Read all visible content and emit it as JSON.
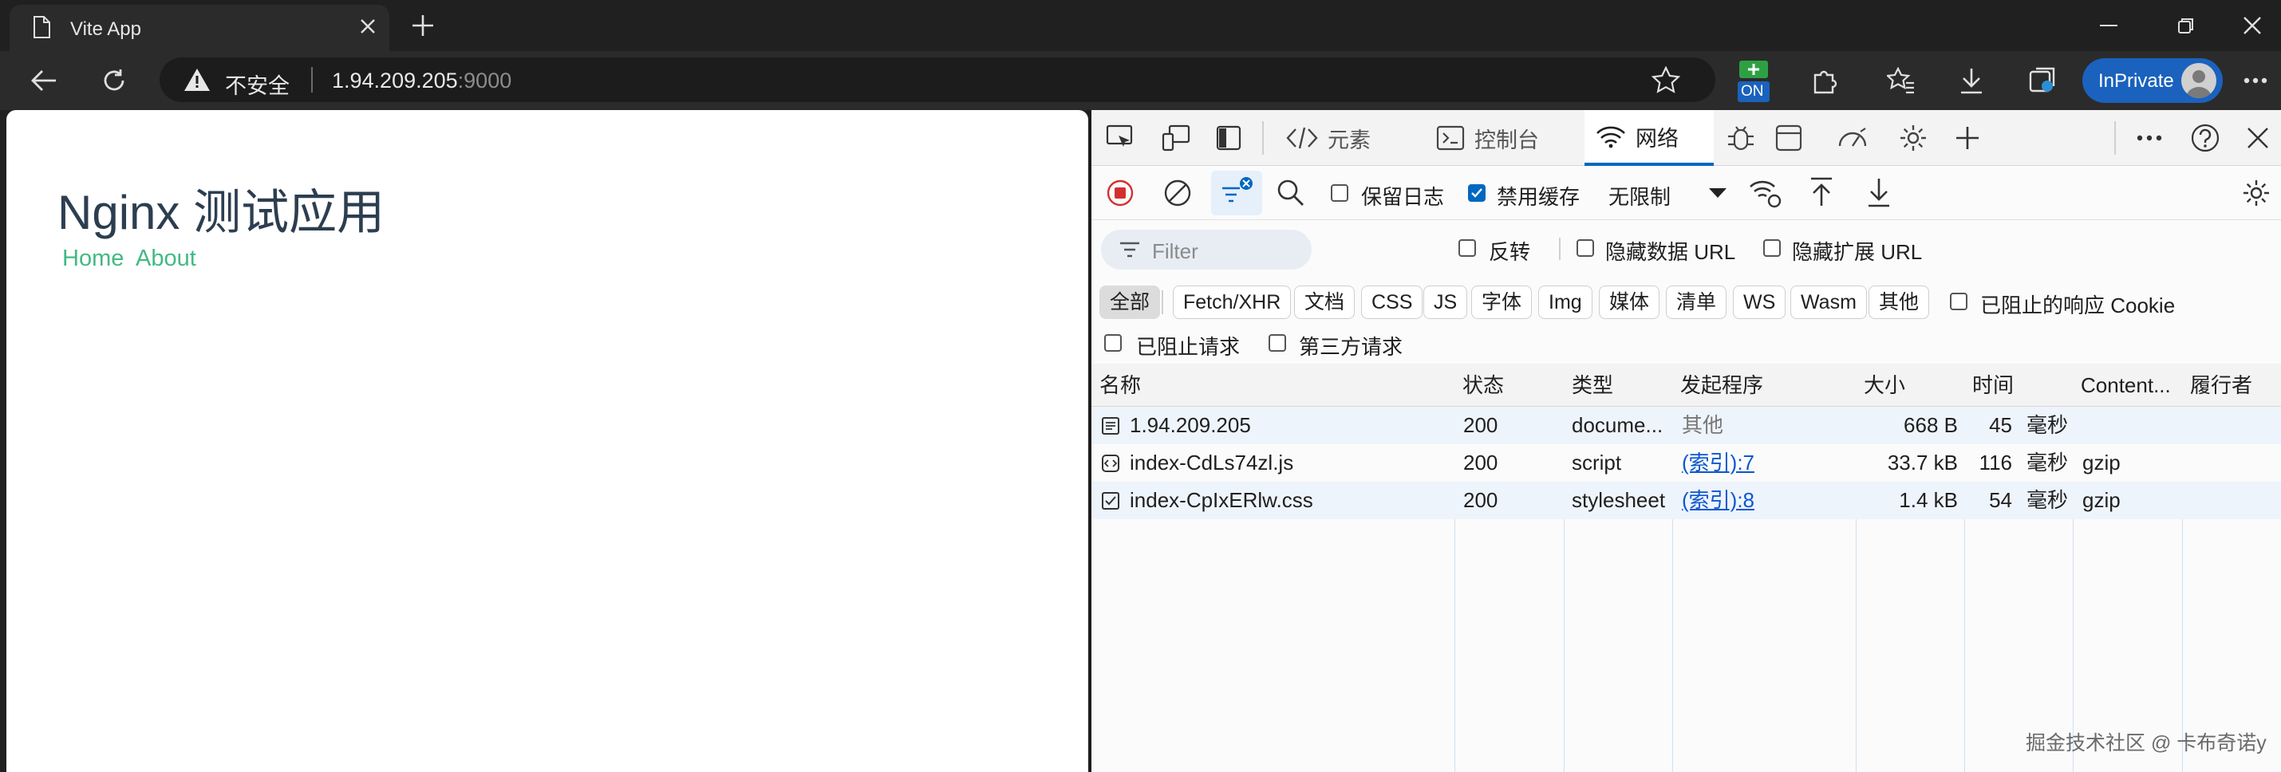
{
  "browser": {
    "tab_title": "Vite App",
    "address_warning": "不安全",
    "url_host": "1.94.209.205",
    "url_port": ":9000",
    "inprivate_label": "InPrivate",
    "extension_badge": "ON"
  },
  "page": {
    "heading": "Nginx 测试应用",
    "nav": [
      "Home",
      "About"
    ]
  },
  "devtools": {
    "tabs": {
      "elements": "元素",
      "console": "控制台",
      "network": "网络"
    },
    "toolbar": {
      "preserve_log": "保留日志",
      "disable_cache": "禁用缓存",
      "throttle": "无限制"
    },
    "filter": {
      "placeholder": "Filter",
      "invert": "反转",
      "hide_data_urls": "隐藏数据 URL",
      "hide_extension_urls": "隐藏扩展 URL"
    },
    "type_filters": [
      "全部",
      "Fetch/XHR",
      "文档",
      "CSS",
      "JS",
      "字体",
      "Img",
      "媒体",
      "清单",
      "WS",
      "Wasm",
      "其他"
    ],
    "blocked_cookies": "已阻止的响应 Cookie",
    "blocked_requests": "已阻止请求",
    "third_party": "第三方请求",
    "columns": [
      "名称",
      "状态",
      "类型",
      "发起程序",
      "大小",
      "时间",
      "Content...",
      "履行者"
    ],
    "rows": [
      {
        "name": "1.94.209.205",
        "status": "200",
        "type": "docume...",
        "initiator": "其他",
        "initiator_link": false,
        "size": "668 B",
        "time": "45",
        "time_unit": "毫秒",
        "content": "",
        "fulfilled": ""
      },
      {
        "name": "index-CdLs74zl.js",
        "status": "200",
        "type": "script",
        "initiator": "(索引):7",
        "initiator_link": true,
        "size": "33.7 kB",
        "time": "116",
        "time_unit": "毫秒",
        "content": "gzip",
        "fulfilled": ""
      },
      {
        "name": "index-CpIxERlw.css",
        "status": "200",
        "type": "stylesheet",
        "initiator": "(索引):8",
        "initiator_link": true,
        "size": "1.4 kB",
        "time": "54",
        "time_unit": "毫秒",
        "content": "gzip",
        "fulfilled": ""
      }
    ]
  },
  "watermark": "掘金技术社区 @ 卡布奇诺y"
}
